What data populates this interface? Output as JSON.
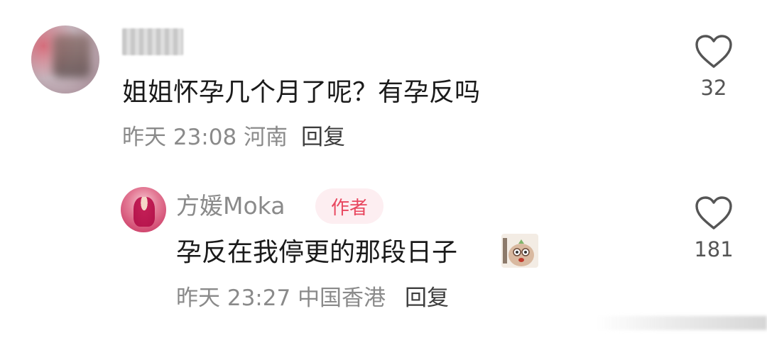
{
  "comments": [
    {
      "text": "姐姐怀孕几个月了呢？有孕反吗",
      "time": "昨天 23:08",
      "location": "河南",
      "reply_label": "回复",
      "likes": "32"
    }
  ],
  "reply": {
    "author_name": "方媛Moka",
    "author_badge": "作者",
    "text": "孕反在我停更的那段日子",
    "time": "昨天 23:27",
    "location": "中国香港",
    "reply_label": "回复",
    "likes": "181"
  },
  "icons": {
    "like": "heart-outline-icon",
    "sticker": "emoji-sticker-icon"
  },
  "colors": {
    "badge_text": "#e8475f",
    "badge_bg": "#fdeef1",
    "meta_text": "#8a8a8a",
    "main_text": "#1a1a1a"
  }
}
